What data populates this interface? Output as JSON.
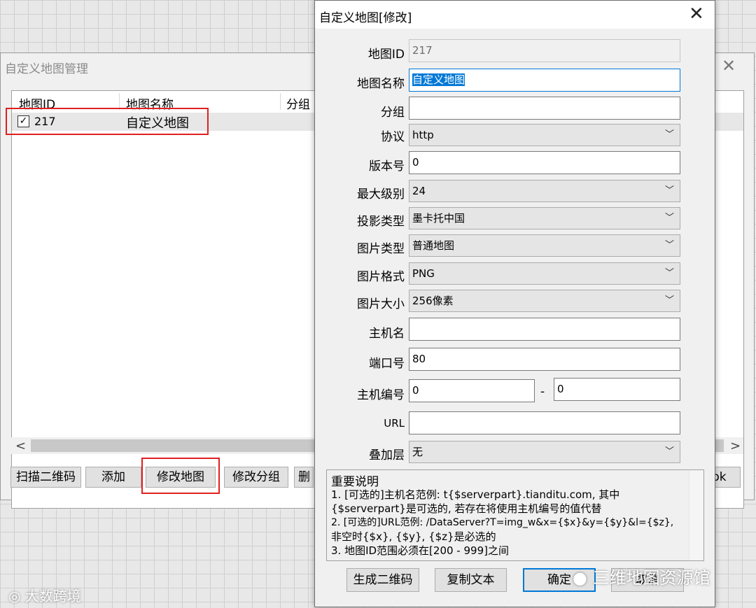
{
  "manager": {
    "title": "自定义地图管理",
    "close": "✕",
    "columns": [
      "地图ID",
      "地图名称",
      "分组"
    ],
    "rows": [
      {
        "checked": "✓",
        "id": "217",
        "name": "自定义地图"
      }
    ],
    "scroll_left": "<",
    "scroll_right": ">",
    "buttons": [
      "扫描二维码",
      "添加",
      "修改地图",
      "修改分组",
      "删",
      "pk"
    ]
  },
  "dialog": {
    "title": "自定义地图[修改]",
    "close": "✕",
    "labels": {
      "map_id": "地图ID",
      "map_name": "地图名称",
      "group": "分组",
      "protocol": "协议",
      "version": "版本号",
      "max_level": "最大级别",
      "projection": "投影类型",
      "image_type": "图片类型",
      "image_format": "图片格式",
      "image_size": "图片大小",
      "host": "主机名",
      "port": "端口号",
      "host_number": "主机编号",
      "url": "URL",
      "overlay": "叠加层"
    },
    "values": {
      "map_id": "217",
      "map_name": "自定义地图",
      "group": "",
      "protocol": "http",
      "version": "0",
      "max_level": "24",
      "projection": "墨卡托中国",
      "image_type": "普通地图",
      "image_format": "PNG",
      "image_size": "256像素",
      "host": "",
      "port": "80",
      "host_number_from": "0",
      "host_number_sep": "-",
      "host_number_to": "0",
      "url": "",
      "overlay": "无"
    },
    "notes": [
      "重要说明",
      "1. [可选的]主机名范例: t{$serverpart}.tianditu.com, 其中",
      "{$serverpart}是可选的, 若存在将使用主机编号的值代替",
      "2. [可选的]URL范例: /DataServer?T=img_w&x={$x}&y={$y}&l={$z},",
      "非空时{$x}, {$y}, {$z}是必选的",
      "3. 地图ID范围必须在[200 - 999]之间"
    ],
    "buttons": {
      "qr": "生成二维码",
      "copy": "复制文本",
      "ok": "确定",
      "cancel": "取消"
    }
  },
  "watermarks": {
    "left": "大数跨境",
    "right": "三维地图资源馆"
  },
  "colors": {
    "highlight_red": "#e02020",
    "focus_blue": "#0078d7"
  }
}
